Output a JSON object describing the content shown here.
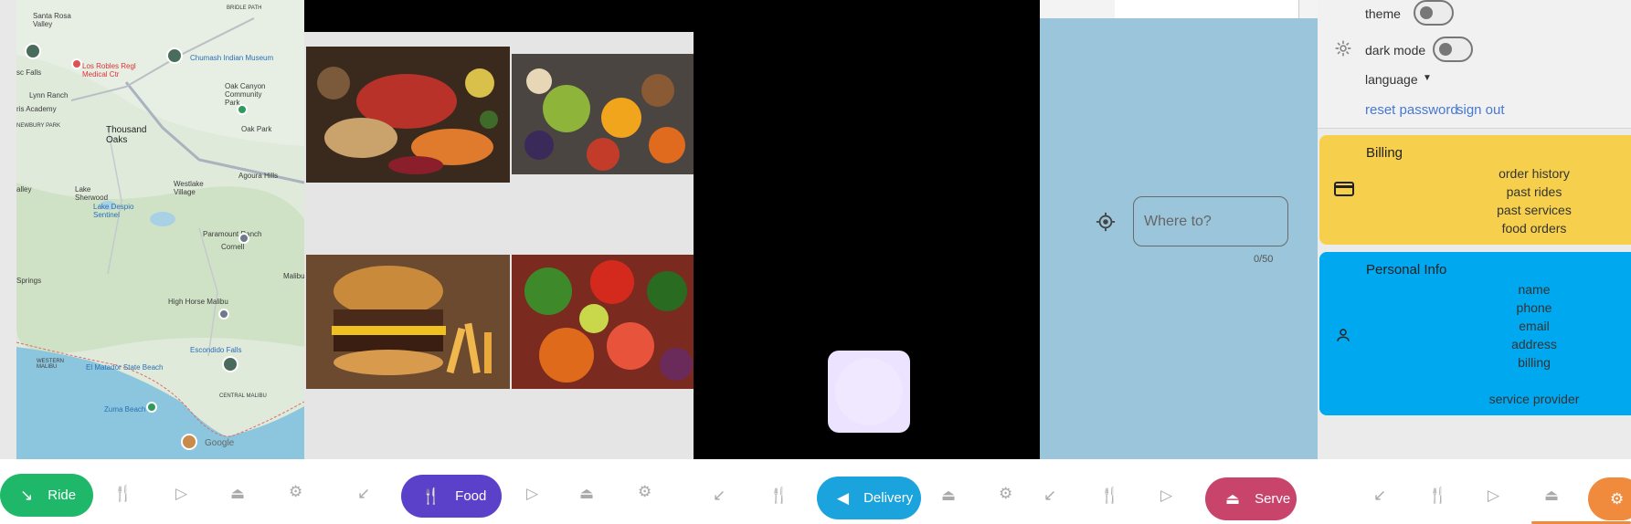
{
  "map": {
    "labels": {
      "santa_rosa_valley": "Santa Rosa\nValley",
      "bridle_path": "BRIDLE PATH",
      "chumash": "Chumash Indian Museum",
      "los_robles": "Los Robles Regl\nMedical Ctr",
      "lynn_ranch": "Lynn Ranch",
      "oak_canyon": "Oak Canyon\nCommunity\nPark",
      "thousand_oaks": "Thousand\nOaks",
      "oak_park": "Oak Park",
      "agoura_hills": "Agoura Hills",
      "westlake": "Westlake\nVillage",
      "lake_sherwood": "Lake\nSherwood",
      "lake_despio": "Lake Despio\nSentinel",
      "paramount": "Paramount Ranch",
      "cornell": "Cornell",
      "high_horse": "High Horse Malibu",
      "escondido": "Escondido Falls",
      "el_matador": "El Matador State Beach",
      "western_malibu": "WESTERN\nMALIBU",
      "zuma": "Zuma Beach",
      "central_malibu": "CENTRAL MALIBU",
      "valley": "alley",
      "falls": "sc Falls",
      "academy": "ris Academy",
      "newbury": "NEWBURY PARK",
      "springs": "Springs",
      "malibu_edge": "Malibu",
      "google": "Google"
    }
  },
  "search": {
    "placeholder": "Where to?",
    "counter": "0/50"
  },
  "settings": {
    "theme_label": "theme",
    "dark_mode_label": "dark mode",
    "language_label": "language",
    "reset_password": "reset password",
    "sign_out": "sign out"
  },
  "billing": {
    "title": "Billing",
    "items": [
      "order history",
      "past rides",
      "past services",
      "food orders"
    ]
  },
  "personal": {
    "title": "Personal Info",
    "items": [
      "name",
      "phone",
      "email",
      "address",
      "billing"
    ],
    "extra": "service provider"
  },
  "nav": {
    "ride": "Ride",
    "food": "Food",
    "delivery": "Delivery",
    "serve": "Serve"
  },
  "colors": {
    "ride": "#1fb86a",
    "food": "#5b41c9",
    "delivery": "#1aa3dd",
    "serve": "#c9446b",
    "settings_orange": "#f08a3c",
    "billing_yellow": "#f6d04d",
    "personal_blue": "#00a8ef"
  }
}
